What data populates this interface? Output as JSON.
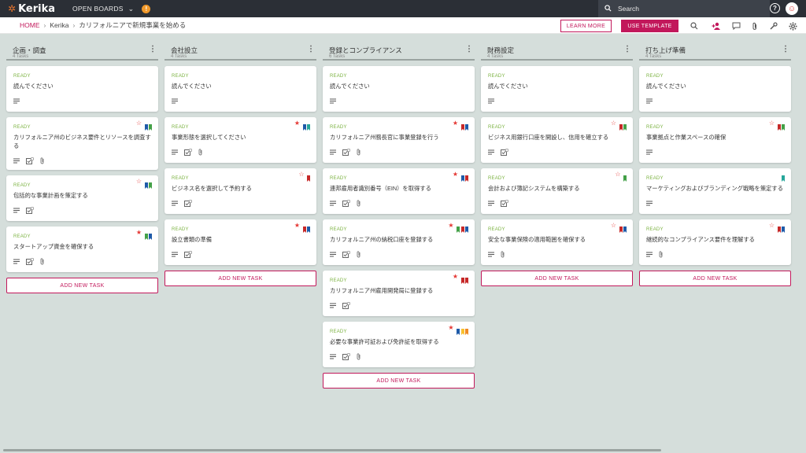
{
  "topbar": {
    "logo": "Kerika",
    "open_boards": "OPEN BOARDS",
    "notification_count": "!",
    "search_placeholder": "Search"
  },
  "breadcrumb": {
    "home": "HOME",
    "team": "Kerika",
    "board": "カリフォルニアで新規事業を始める"
  },
  "actions": {
    "learn_more": "LEARN MORE",
    "use_template": "USE TEMPLATE"
  },
  "columns": [
    {
      "title": "企画・調査",
      "count": "4 Tasks",
      "add_label": "ADD NEW TASK",
      "cards": [
        {
          "status": "READY",
          "title": "読んでください"
        },
        {
          "status": "READY",
          "title": "カリフォルニア州のビジネス要件とリソースを調査する"
        },
        {
          "status": "READY",
          "title": "包括的な事業計画を策定する"
        },
        {
          "status": "READY",
          "title": "スタートアップ資金を確保する"
        }
      ]
    },
    {
      "title": "会社設立",
      "count": "4 Tasks",
      "add_label": "ADD NEW TASK",
      "cards": [
        {
          "status": "READY",
          "title": "読んでください"
        },
        {
          "status": "READY",
          "title": "事業形態を選択してください"
        },
        {
          "status": "READY",
          "title": "ビジネス名を選択して予約する"
        },
        {
          "status": "READY",
          "title": "設立書類の準備"
        }
      ]
    },
    {
      "title": "登録とコンプライアンス",
      "count": "6 Tasks",
      "add_label": "ADD NEW TASK",
      "cards": [
        {
          "status": "READY",
          "title": "読んでください"
        },
        {
          "status": "READY",
          "title": "カリフォルニア州務長官に事業登録を行う"
        },
        {
          "status": "READY",
          "title": "連邦雇用者識別番号（EIN）を取得する"
        },
        {
          "status": "READY",
          "title": "カリフォルニア州の納税口座を登録する"
        },
        {
          "status": "READY",
          "title": "カリフォルニア州雇用開発局に登録する"
        },
        {
          "status": "READY",
          "title": "必要な事業許可証および免許証を取得する"
        }
      ]
    },
    {
      "title": "財務設定",
      "count": "4 Tasks",
      "add_label": "ADD NEW TASK",
      "cards": [
        {
          "status": "READY",
          "title": "読んでください"
        },
        {
          "status": "READY",
          "title": "ビジネス用銀行口座を開設し、信用を確立する"
        },
        {
          "status": "READY",
          "title": "会計および簿記システムを構築する"
        },
        {
          "status": "READY",
          "title": "安全な事業保険の適用範囲を確保する"
        }
      ]
    },
    {
      "title": "打ち上げ準備",
      "count": "4 Tasks",
      "add_label": "ADD NEW TASK",
      "cards": [
        {
          "status": "READY",
          "title": "読んでください"
        },
        {
          "status": "READY",
          "title": "事業拠点と作業スペースの確保"
        },
        {
          "status": "READY",
          "title": "マーケティングおよびブランディング戦略を策定する"
        },
        {
          "status": "READY",
          "title": "継続的なコンプライアンス要件を理解する"
        }
      ]
    }
  ],
  "colors": {
    "accent": "#c2185b",
    "ready": "#7cb342",
    "topbar": "#2b2f36",
    "board_bg": "#d5dedb",
    "tag_blue": "#1e5aa8",
    "tag_green": "#43a047",
    "tag_teal": "#26a69a",
    "tag_red": "#c62828",
    "tag_yellow": "#f9c02d",
    "tag_orange": "#f08a24"
  }
}
